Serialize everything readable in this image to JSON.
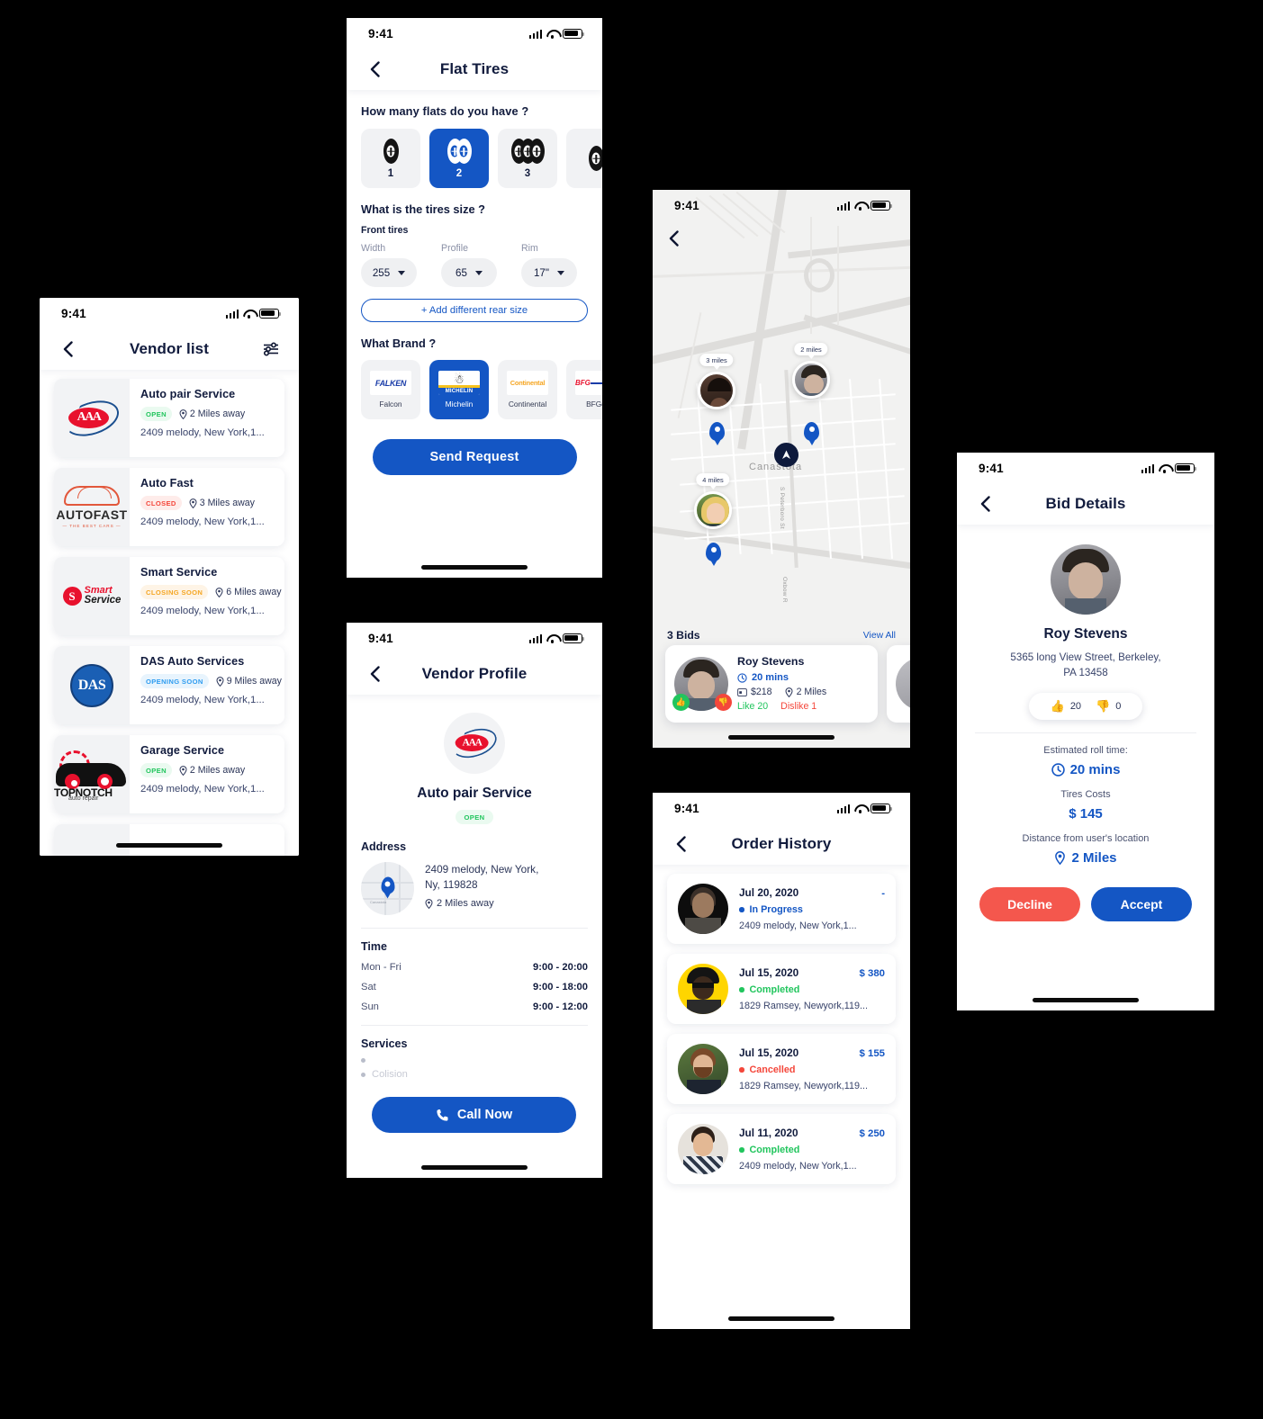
{
  "status_bar": {
    "time": "9:41"
  },
  "vendor_list": {
    "title": "Vendor list",
    "back_icon": "chevron-left-icon",
    "filter_icon": "filter-sliders-icon",
    "vendors": [
      {
        "name": "Auto pair Service",
        "status": "OPEN",
        "status_kind": "open",
        "distance": "2 Miles away",
        "address": "2409 melody, New York,1...",
        "logo": "aaa"
      },
      {
        "name": "Auto Fast",
        "status": "CLOSED",
        "status_kind": "closed",
        "distance": "3 Miles away",
        "address": "2409 melody, New York,1...",
        "logo": "autofast"
      },
      {
        "name": "Smart Service",
        "status": "CLOSING SOON",
        "status_kind": "closing",
        "distance": "6 Miles away",
        "address": "2409 melody, New York,1...",
        "logo": "smart"
      },
      {
        "name": "DAS Auto Services",
        "status": "OPENING SOON",
        "status_kind": "opening",
        "distance": "9 Miles away",
        "address": "2409 melody, New York,1...",
        "logo": "das"
      },
      {
        "name": "Garage Service",
        "status": "OPEN",
        "status_kind": "open",
        "distance": "2 Miles away",
        "address": "2409 melody, New York,1...",
        "logo": "topnotch"
      }
    ]
  },
  "flat_tires": {
    "title": "Flat Tires",
    "question_count": "How many flats do you have ?",
    "count_options": [
      {
        "label": "1",
        "tires": 1,
        "selected": false
      },
      {
        "label": "2",
        "tires": 2,
        "selected": true
      },
      {
        "label": "3",
        "tires": 3,
        "selected": false
      }
    ],
    "question_size": "What is the tires size ?",
    "front_tires_label": "Front tires",
    "size_fields": [
      {
        "label": "Width",
        "value": "255"
      },
      {
        "label": "Profile",
        "value": "65"
      },
      {
        "label": "Rim",
        "value": "17\""
      }
    ],
    "add_rear_label": "+ Add different rear size",
    "question_brand": "What Brand ?",
    "brands": [
      {
        "name": "Falcon",
        "wordmark": "FALKEN",
        "selected": false
      },
      {
        "name": "Michelin",
        "wordmark": "MICHELIN",
        "selected": true
      },
      {
        "name": "Continental",
        "wordmark": "Continental",
        "selected": false
      },
      {
        "name": "BFGo",
        "wordmark": "BFG",
        "selected": false
      }
    ],
    "send_label": "Send Request"
  },
  "vendor_profile": {
    "title": "Vendor Profile",
    "name": "Auto pair Service",
    "status": "OPEN",
    "address_heading": "Address",
    "address_line1": "2409 melody, New York,",
    "address_line2": "Ny, 119828",
    "address_distance": "2 Miles away",
    "time_heading": "Time",
    "hours": [
      {
        "day": "Mon - Fri",
        "value": "9:00 - 20:00"
      },
      {
        "day": "Sat",
        "value": "9:00 - 18:00"
      },
      {
        "day": "Sun",
        "value": "9:00 - 12:00"
      }
    ],
    "services_heading": "Services",
    "services": [
      "",
      "Colision"
    ],
    "call_label": "Call Now",
    "call_icon": "phone-icon"
  },
  "map_screen": {
    "back_icon": "chevron-left-icon",
    "place_label": "Canastota",
    "street_label_1": "S Peterboro St",
    "street_label_2": "Oxbow R",
    "markers": [
      {
        "label": "3 miles",
        "avatar": "dark-man"
      },
      {
        "label": "2 miles",
        "avatar": "young-man"
      },
      {
        "label": "4 miles",
        "avatar": "blonde-woman"
      }
    ],
    "bids_count": "3 Bids",
    "view_all": "View  All",
    "bids": [
      {
        "name": "Roy Stevens",
        "time": "20 mins",
        "price": "$218",
        "distance": "2 Miles",
        "likes": "Like 20",
        "dislikes": "Dislike 1"
      }
    ]
  },
  "order_history": {
    "title": "Order History",
    "orders": [
      {
        "date": "Jul 20, 2020",
        "price": "-",
        "status": "In Progress",
        "status_kind": "progress",
        "address": "2409 melody, New York,1..."
      },
      {
        "date": "Jul 15, 2020",
        "price": "$ 380",
        "status": "Completed",
        "status_kind": "done",
        "address": "1829 Ramsey, Newyork,119..."
      },
      {
        "date": "Jul 15, 2020",
        "price": "$ 155",
        "status": "Cancelled",
        "status_kind": "cancel",
        "address": "1829 Ramsey, Newyork,119..."
      },
      {
        "date": "Jul 11, 2020",
        "price": "$ 250",
        "status": "Completed",
        "status_kind": "done",
        "address": "2409 melody, New York,1..."
      }
    ]
  },
  "bid_details": {
    "title": "Bid Details",
    "name": "Roy Stevens",
    "address_line1": "5365 long View Street, Berkeley,",
    "address_line2": "PA 13458",
    "likes": "20",
    "dislikes": "0",
    "roll_time_label": "Estimated roll time:",
    "roll_time_value": "20 mins",
    "cost_label": "Tires Costs",
    "cost_value": "$ 145",
    "distance_label": "Distance from user's location",
    "distance_value": "2 Miles",
    "decline_label": "Decline",
    "accept_label": "Accept"
  },
  "colors": {
    "primary": "#1456c4",
    "danger": "#f4473b",
    "success": "#21c55d",
    "warning": "#f5a623",
    "info": "#2e9cf0",
    "text_dark": "#111b3d"
  }
}
